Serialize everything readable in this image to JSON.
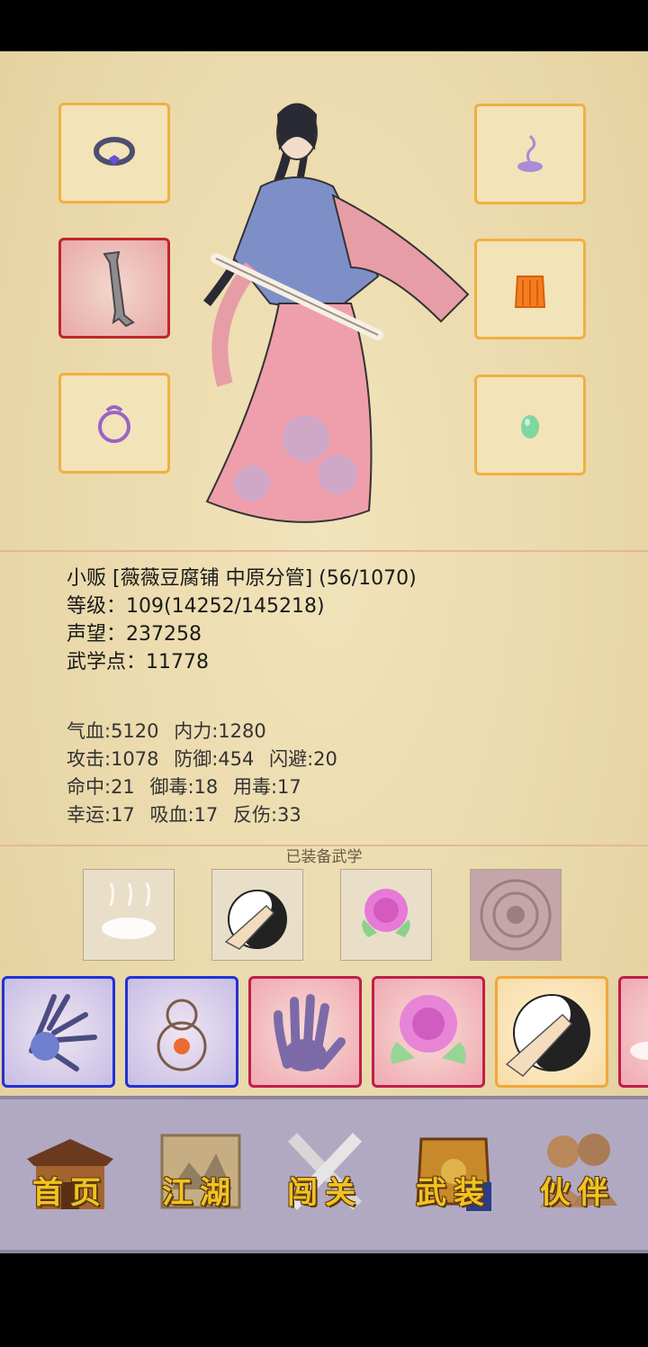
{
  "character": {
    "title_line": "小贩 [薇薇豆腐铺 中原分管] (56/1070)",
    "level_line": "等级：109(14252/145218)",
    "reputation_line": "声望：237258",
    "martial_points_line": "武学点：11778"
  },
  "stats": {
    "row1": [
      "气血:5120",
      "内力:1280"
    ],
    "row2": [
      "攻击:1078",
      "防御:454",
      "闪避:20"
    ],
    "row3": [
      "命中:21",
      "御毒:18",
      "用毒:17"
    ],
    "row4": [
      "幸运:17",
      "吸血:17",
      "反伤:33"
    ]
  },
  "equipped_title": "已装备武学",
  "equipment_slots": [
    {
      "name": "ring-icon",
      "rarity": "normal"
    },
    {
      "name": "sword-icon",
      "rarity": "rare"
    },
    {
      "name": "bracelet-icon",
      "rarity": "normal"
    },
    {
      "name": "incense-icon",
      "rarity": "normal"
    },
    {
      "name": "armor-icon",
      "rarity": "normal"
    },
    {
      "name": "jade-icon",
      "rarity": "normal"
    }
  ],
  "equipped_skills": [
    "mist-icon",
    "taiji-palm-icon",
    "rose-icon",
    "seal-icon"
  ],
  "skill_cards": [
    {
      "icon": "claw-hand-icon",
      "rarity": "blue"
    },
    {
      "icon": "gourd-icon",
      "rarity": "blue"
    },
    {
      "icon": "palm-icon",
      "rarity": "red"
    },
    {
      "icon": "rose-icon",
      "rarity": "red"
    },
    {
      "icon": "taiji-palm-icon",
      "rarity": "orange"
    },
    {
      "icon": "mist-icon",
      "rarity": "red"
    }
  ],
  "nav": {
    "home": "首页",
    "jianghu": "江湖",
    "challenge": "闯关",
    "equipment": "武装",
    "partner": "伙伴"
  },
  "colors": {
    "slot_border": "#f0b040",
    "rare_border": "#c0252a",
    "blue_border": "#2231d7",
    "nav_text": "#f2c320"
  }
}
